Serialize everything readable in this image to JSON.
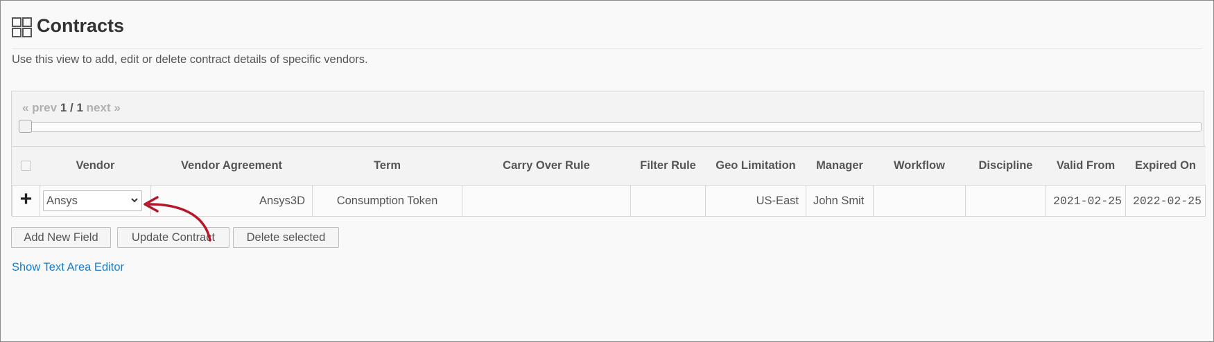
{
  "page": {
    "title": "Contracts",
    "description": "Use this view to add, edit or delete contract details of specific vendors."
  },
  "pager": {
    "prev": "« prev",
    "current": "1 / 1",
    "next": "next »"
  },
  "table": {
    "columns": [
      "Vendor",
      "Vendor Agreement",
      "Term",
      "Carry Over Rule",
      "Filter Rule",
      "Geo Limitation",
      "Manager",
      "Workflow",
      "Discipline",
      "Valid From",
      "Expired On"
    ],
    "rows": [
      {
        "vendor": "Ansys",
        "vendor_agreement": "Ansys3D",
        "term": "Consumption Token",
        "carry_over_rule": "",
        "filter_rule": "",
        "geo_limitation": "US-East",
        "manager": "John Smit",
        "workflow": "",
        "discipline": "",
        "valid_from": "2021-02-25",
        "expired_on": "2022-02-25"
      }
    ]
  },
  "buttons": {
    "add_new_field": "Add New Field",
    "update_contract": "Update Contract",
    "delete_selected": "Delete selected"
  },
  "links": {
    "show_text_area_editor": "Show Text Area Editor"
  },
  "icons": {
    "title": "dashboard-grid-icon",
    "add_row": "plus-icon",
    "dropdown": "chevron-down-icon",
    "annotation": "curved-arrow-icon"
  },
  "colors": {
    "link": "#1a7ec8",
    "annotation_arrow": "#b5172b",
    "header_bg": "#f3f3f3"
  }
}
